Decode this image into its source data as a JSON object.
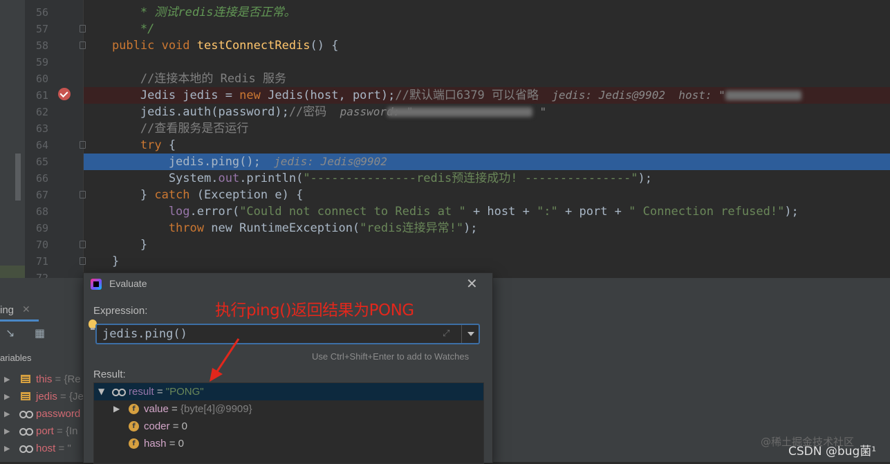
{
  "editor": {
    "lines": [
      {
        "n": "56",
        "parts": [
          [
            "doc",
            "        * 测试redis连接是否正常。"
          ]
        ]
      },
      {
        "n": "57",
        "parts": [
          [
            "doc",
            "        */"
          ]
        ]
      },
      {
        "n": "58",
        "parts": [
          [
            "kw",
            "    public void "
          ],
          [
            "fn",
            "testConnectRedis"
          ],
          [
            "t",
            "() {"
          ]
        ]
      },
      {
        "n": "59",
        "parts": []
      },
      {
        "n": "60",
        "parts": [
          [
            "cm",
            "        //连接本地的 Redis 服务"
          ]
        ]
      },
      {
        "n": "61",
        "parts": [
          [
            "t",
            "        Jedis jedis = "
          ],
          [
            "kw",
            "new "
          ],
          [
            "t",
            "Jedis(host, port);"
          ],
          [
            "cm",
            "//默认端口6379 可以省略"
          ],
          [
            "hint",
            "  jedis: Jedis@9902  host: \""
          ]
        ]
      },
      {
        "n": "62",
        "parts": [
          [
            "t",
            "        jedis.auth(password);"
          ],
          [
            "cm",
            "//密码"
          ],
          [
            "hint",
            "  password: \"                   \""
          ]
        ]
      },
      {
        "n": "63",
        "parts": [
          [
            "cm",
            "        //查看服务是否运行"
          ]
        ]
      },
      {
        "n": "64",
        "parts": [
          [
            "kw",
            "        try "
          ],
          [
            "t",
            "{"
          ]
        ]
      },
      {
        "n": "65",
        "parts": [
          [
            "t",
            "            jedis.ping();"
          ],
          [
            "hint",
            "  jedis: Jedis@9902"
          ]
        ]
      },
      {
        "n": "66",
        "parts": [
          [
            "t",
            "            System."
          ],
          [
            "par",
            "out"
          ],
          [
            "t",
            ".println("
          ],
          [
            "str",
            "\"---------------redis预连接成功! ---------------\""
          ],
          [
            "t",
            ");"
          ]
        ]
      },
      {
        "n": "67",
        "parts": [
          [
            "t",
            "        } "
          ],
          [
            "kw",
            "catch "
          ],
          [
            "t",
            "(Exception e) {"
          ]
        ]
      },
      {
        "n": "68",
        "parts": [
          [
            "par",
            "            log"
          ],
          [
            "t",
            ".error("
          ],
          [
            "str",
            "\"Could not connect to Redis at \""
          ],
          [
            "t",
            " + host + "
          ],
          [
            "str",
            "\":\""
          ],
          [
            "t",
            " + port + "
          ],
          [
            "str",
            "\" Connection refused!\""
          ],
          [
            "t",
            ");"
          ]
        ]
      },
      {
        "n": "69",
        "parts": [
          [
            "kw",
            "            throw "
          ],
          [
            "t",
            "new RuntimeException("
          ],
          [
            "str",
            "\"redis连接异常!\""
          ],
          [
            "t",
            ");"
          ]
        ]
      },
      {
        "n": "70",
        "parts": [
          [
            "t",
            "        }"
          ]
        ]
      },
      {
        "n": "71",
        "parts": [
          [
            "t",
            "    }"
          ]
        ]
      },
      {
        "n": "72",
        "parts": []
      }
    ]
  },
  "debug_panel": {
    "tab_label": "ing",
    "variables_header": "ariables",
    "variables": [
      {
        "name": "this",
        "value": " = {Re"
      },
      {
        "name": "jedis",
        "value": " = {Je"
      },
      {
        "name": "password",
        "value": ""
      },
      {
        "name": "port",
        "value": " = {In"
      },
      {
        "name": "host",
        "value": " = \""
      }
    ]
  },
  "dialog": {
    "title": "Evaluate",
    "expression_label": "Expression:",
    "annotation": "执行ping()返回结果为PONG",
    "expression_value": "jedis.ping()",
    "watch_hint": "Use Ctrl+Shift+Enter to add to Watches",
    "result_label": "Result:",
    "result": {
      "name": "result",
      "eq": " = ",
      "value": "\"PONG\""
    },
    "children": [
      {
        "name": "value",
        "eq": " = ",
        "value": "{byte[4]@9909}",
        "expandable": true
      },
      {
        "name": "coder",
        "eq": " = ",
        "value": "0",
        "expandable": false
      },
      {
        "name": "hash",
        "eq": " = ",
        "value": "0",
        "expandable": false
      }
    ]
  },
  "watermark": "@稀土掘金技术社区",
  "csdn": "CSDN @bug菌¹",
  "colors": {
    "accent": "#2d5d9a",
    "annotation": "#e2271c",
    "breakpoint": "#c75450"
  }
}
